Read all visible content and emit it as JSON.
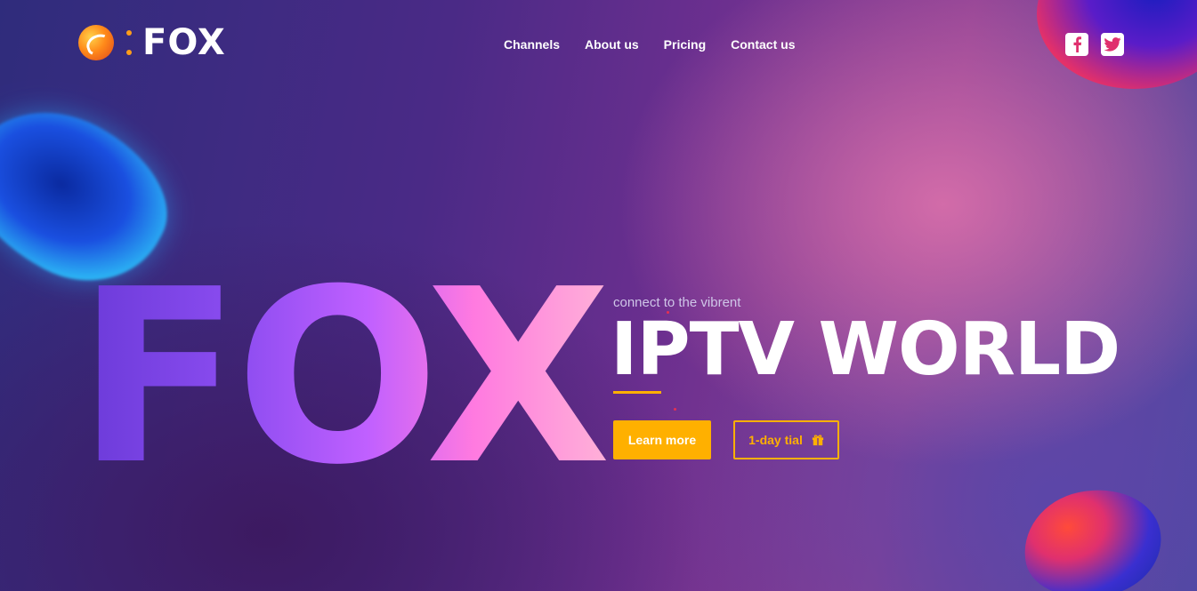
{
  "brand": {
    "name": "FOX",
    "accent_color": "#ffb000",
    "logo_icon": "fox-logo-icon"
  },
  "nav": {
    "items": [
      {
        "label": "Channels"
      },
      {
        "label": "About us"
      },
      {
        "label": "Pricing"
      },
      {
        "label": "Contact us"
      }
    ]
  },
  "social": {
    "facebook_icon": "facebook-icon",
    "twitter_icon": "twitter-icon",
    "icon_color": "#e0306e"
  },
  "hero": {
    "big_word": "FOX",
    "tagline": "connect to the vibrent",
    "headline": "IPTV WORLD",
    "primary_button": "Learn more",
    "secondary_button": "1-day tial",
    "secondary_icon": "gift-icon"
  }
}
